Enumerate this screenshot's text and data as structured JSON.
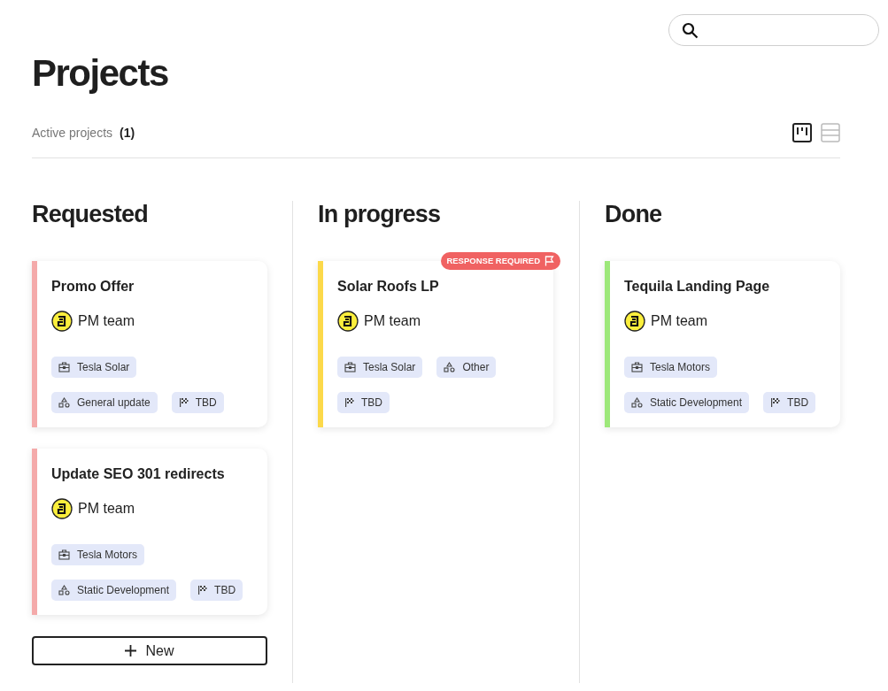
{
  "title": "Projects",
  "summary": {
    "label": "Active projects",
    "count": "(1)"
  },
  "view_toggle": [
    {
      "kind": "board",
      "selected": true
    },
    {
      "kind": "list",
      "selected": false
    }
  ],
  "columns": [
    {
      "title": "Requested",
      "new_button": "New",
      "cards": [
        {
          "title": "Promo Offer",
          "color": "#f4aaaa",
          "team": "PM team",
          "tag_rows": [
            [
              {
                "kind": "client",
                "label": "Tesla Solar"
              }
            ],
            [
              {
                "kind": "category",
                "label": "General update"
              },
              {
                "kind": "milestone",
                "label": "TBD"
              }
            ]
          ]
        },
        {
          "title": "Update SEO 301 redirects",
          "color": "#f4aaaa",
          "team": "PM team",
          "tag_rows": [
            [
              {
                "kind": "client",
                "label": "Tesla Motors"
              }
            ],
            [
              {
                "kind": "category",
                "label": "Static Development"
              },
              {
                "kind": "milestone",
                "label": "TBD"
              }
            ]
          ]
        }
      ]
    },
    {
      "title": "In progress",
      "cards": [
        {
          "title": "Solar Roofs LP",
          "color": "#fcd94a",
          "team": "PM team",
          "badge": "RESPONSE REQUIRED",
          "tag_rows": [
            [
              {
                "kind": "client",
                "label": "Tesla Solar"
              },
              {
                "kind": "category",
                "label": "Other"
              }
            ],
            [
              {
                "kind": "milestone",
                "label": "TBD"
              }
            ]
          ]
        }
      ]
    },
    {
      "title": "Done",
      "cards": [
        {
          "title": "Tequila Landing Page",
          "color": "#9de87a",
          "team": "PM team",
          "tag_rows": [
            [
              {
                "kind": "client",
                "label": "Tesla Motors"
              }
            ],
            [
              {
                "kind": "category",
                "label": "Static Development"
              },
              {
                "kind": "milestone",
                "label": "TBD"
              }
            ]
          ]
        }
      ]
    }
  ]
}
